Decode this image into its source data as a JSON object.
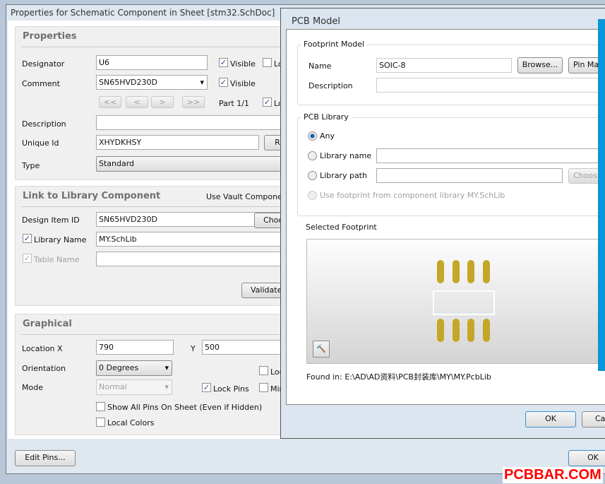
{
  "props_dialog": {
    "title": "Properties for Schematic Component in Sheet [stm32.SchDoc]",
    "properties": {
      "heading": "Properties",
      "designator_label": "Designator",
      "designator": "U6",
      "visible_label": "Visible",
      "lock_label": "Lo",
      "comment_label": "Comment",
      "comment": "SN65HVD230D",
      "visible2_label": "Visible",
      "nav": [
        "<<",
        "<",
        ">",
        ">>"
      ],
      "part": "Part 1/1",
      "lock2_label": "Lo",
      "description_label": "Description",
      "description": "",
      "unique_id_label": "Unique Id",
      "unique_id": "XHYDKHSY",
      "reset_label": "Res",
      "type_label": "Type",
      "type": "Standard"
    },
    "link": {
      "heading": "Link to Library Component",
      "vault_label": "Use Vault Componen",
      "design_item_label": "Design Item ID",
      "design_item": "SN65HVD230D",
      "choose_label": "Choos",
      "library_name_label": "Library Name",
      "library_name": "MY.SchLib",
      "table_name_label": "Table Name",
      "table_name": "",
      "validate_label": "Validate L"
    },
    "graphical": {
      "heading": "Graphical",
      "location_label": "Location  X",
      "x": "790",
      "y_label": "Y",
      "y": "500",
      "orientation_label": "Orientation",
      "orientation": "0 Degrees",
      "mode_label": "Mode",
      "mode": "Normal",
      "lock_label": "Loc",
      "lock_pins_label": "Lock Pins",
      "mirror_label": "Mir",
      "show_pins_label": "Show All Pins On Sheet (Even if Hidden)",
      "local_colors_label": "Local Colors"
    },
    "edit_pins": "Edit Pins...",
    "ok": "OK"
  },
  "pcb_dialog": {
    "title": "PCB Model",
    "footprint": {
      "heading": "Footprint Model",
      "name_label": "Name",
      "name": "SOIC-8",
      "browse": "Browse...",
      "pin_map": "Pin Ma",
      "description_label": "Description",
      "description": ""
    },
    "library": {
      "heading": "PCB Library",
      "any": "Any",
      "library_name": "Library name",
      "library_path": "Library path",
      "choose": "Choos",
      "use_component": "Use footprint from component library MY.SchLib"
    },
    "selected": {
      "heading": "Selected Footprint",
      "found_label": "Found in:",
      "found_path": "E:\\AD\\AD资料\\PCB封装库\\MY\\MY.PcbLib"
    },
    "ok": "OK",
    "cancel": "Car"
  },
  "watermark": "PCBBAR.COM",
  "colors": {
    "pad": "#c4a726",
    "accent": "#0a96d8",
    "watermark": "#ff0000"
  }
}
